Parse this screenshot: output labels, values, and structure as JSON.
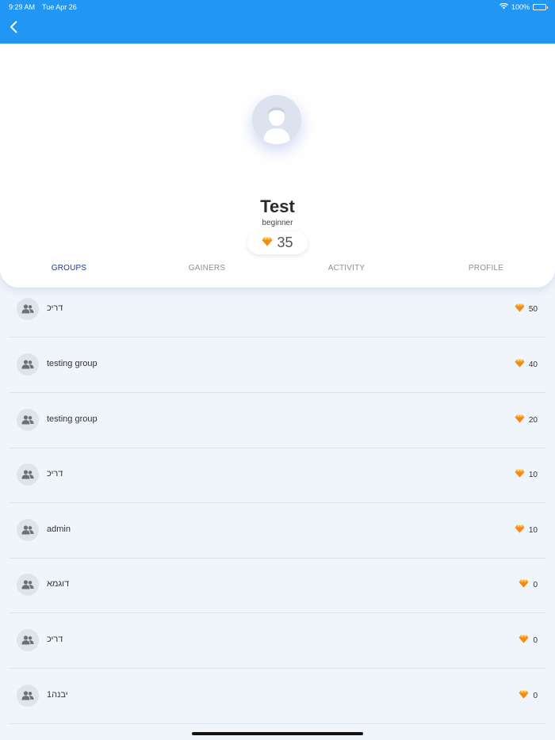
{
  "status_bar": {
    "time": "9:29 AM",
    "date": "Tue Apr 26",
    "battery": "100%"
  },
  "profile": {
    "name": "Test",
    "level": "beginner",
    "points": "35"
  },
  "tabs": [
    {
      "label": "GROUPS",
      "active": true
    },
    {
      "label": "GAINERS",
      "active": false
    },
    {
      "label": "ACTIVITY",
      "active": false
    },
    {
      "label": "PROFILE",
      "active": false
    }
  ],
  "groups": [
    {
      "name": "דריכ",
      "score": "50"
    },
    {
      "name": "testing group",
      "score": "40"
    },
    {
      "name": "testing group",
      "score": "20"
    },
    {
      "name": "דריכ",
      "score": "10"
    },
    {
      "name": "admin",
      "score": "10"
    },
    {
      "name": "דוגמא",
      "score": "0"
    },
    {
      "name": "דריכ",
      "score": "0"
    },
    {
      "name": "יבנה1",
      "score": "0"
    }
  ],
  "colors": {
    "nav": "#2196f3",
    "active_tab": "#1f3a8a",
    "gem": "#f5a623"
  },
  "icons": {
    "back": "chevron-left-icon",
    "group": "group-icon",
    "points": "gem-icon",
    "wifi": "wifi-icon"
  }
}
